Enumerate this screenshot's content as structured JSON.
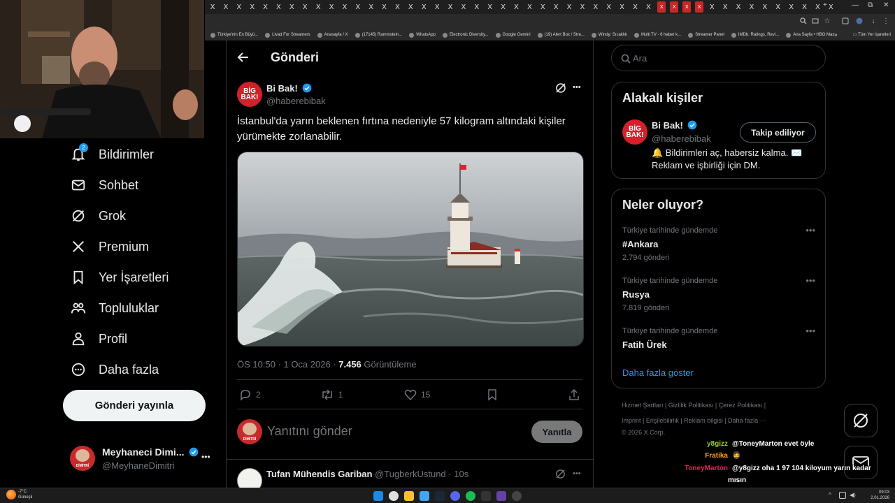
{
  "browser": {
    "tab_glyph": "X",
    "new_tab": "+",
    "win_min": "—",
    "win_max": "⧉",
    "win_close": "✕",
    "bookmarks": [
      "Türkiye'nin En Büyü...",
      "Livad For Streamers",
      "Anasayfa / X",
      "(17145) Rammstein...",
      "WhatsApp",
      "Electronic Diversity...",
      "Google Gemini",
      "(19) Alert Box / Stre...",
      "Windy: Sıcaklık",
      "Multi TV - 6 haber k...",
      "Streamer Panel",
      "IMDb: Ratings, Revi...",
      "Ana Sayfa • HBO Max"
    ],
    "bookmarks_overflow": "»",
    "all_bookmarks": "Tüm Yer İşaretleri"
  },
  "nav": {
    "items": [
      {
        "label": "Bildirimler",
        "icon": "bell-icon",
        "badge": "2"
      },
      {
        "label": "Sohbet",
        "icon": "mail-icon"
      },
      {
        "label": "Grok",
        "icon": "grok-icon"
      },
      {
        "label": "Premium",
        "icon": "x-logo-icon"
      },
      {
        "label": "Yer İşaretleri",
        "icon": "bookmark-icon"
      },
      {
        "label": "Topluluklar",
        "icon": "communities-icon"
      },
      {
        "label": "Profil",
        "icon": "person-icon"
      },
      {
        "label": "Daha fazla",
        "icon": "more-circle-icon"
      }
    ],
    "post_button": "Gönderi yayınla",
    "account": {
      "name": "Meyhaneci Dimi...",
      "handle": "@MeyhaneDimitri",
      "avatar_text": "DİMİTRİ",
      "more": "•••"
    }
  },
  "header": {
    "title": "Gönderi",
    "back": "←"
  },
  "post": {
    "author": "Bi Bak!",
    "handle": "@haberebibak",
    "avatar_text": "BİG BAK!",
    "more": "•••",
    "text": "İstanbul'da yarın beklenen fırtına nedeniyle 57 kilogram altındaki kişiler yürümekte zorlanabilir.",
    "time": "ÖS 10:50 · 1 Oca 2026 · ",
    "views": "7.456",
    "views_label": " Görüntüleme",
    "replies": "2",
    "reposts": "1",
    "likes": "15"
  },
  "reply": {
    "placeholder": "Yanıtını gönder",
    "button": "Yanıtla",
    "avatar_text": "DİMİTRİ"
  },
  "next_post": {
    "author": "Tufan Mühendis Gariban",
    "handle": "@TugberkUstund",
    "time": "· 10s",
    "more": "•••"
  },
  "search": {
    "placeholder": "Ara"
  },
  "related": {
    "title": "Alakalı kişiler",
    "name": "Bi Bak!",
    "handle": "@haberebibak",
    "follow_button": "Takip ediliyor",
    "bio": "🔔 Bildirimleri aç, habersiz kalma. ✉️ Reklam ve işbirliği için DM."
  },
  "trends": {
    "title": "Neler oluyor?",
    "items": [
      {
        "context": "Türkiye tarihinde gündemde",
        "topic": "#Ankara",
        "count": "2.794 gönderi"
      },
      {
        "context": "Türkiye tarihinde gündemde",
        "topic": "Rusya",
        "count": "7.819 gönderi"
      },
      {
        "context": "Türkiye tarihinde gündemde",
        "topic": "Fatih Ürek",
        "count": ""
      }
    ],
    "more_glyph": "•••",
    "show_more": "Daha fazla göster"
  },
  "footer": {
    "line1": "Hizmet Şartları  |  Gizlilik Politikası  |  Çerez Politikası  |",
    "line2": "Imprint  |  Erişilebilirlik  |  Reklam bilgisi  |  Daha fazla ···",
    "copyright": "© 2026 X Corp."
  },
  "chat": [
    {
      "user": "y8gizz",
      "color": "#9acd32",
      "msg": "@ToneyMarton evet öyle"
    },
    {
      "user": "Fratika",
      "color": "#ff9c1a",
      "msg": "🧔"
    },
    {
      "user": "ToneyMarton",
      "color": "#e0245e",
      "msg": "@y8gizz oha 1 97 104 kiloyum yarın kadar"
    },
    {
      "user": "",
      "color": "#ffffff",
      "msg": "mısın"
    }
  ],
  "taskbar": {
    "weather_temp": "-7°C",
    "weather_desc": "Güneşli",
    "time": "09:03",
    "date": "2.01.2026"
  },
  "colors": {
    "accent": "#1d9bf0",
    "brand_red": "#d4202a",
    "bg": "#000000",
    "border": "#2f3336",
    "muted": "#71767b"
  }
}
